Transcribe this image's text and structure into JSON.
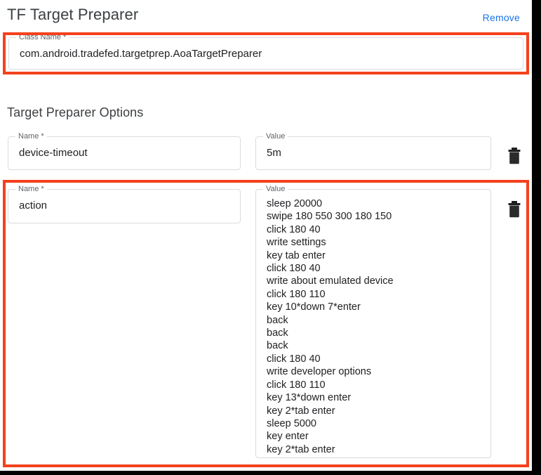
{
  "header": {
    "title": "TF Target Preparer",
    "remove_label": "Remove"
  },
  "class_name_field": {
    "label": "Class Name *",
    "value": "com.android.tradefed.targetprep.AoaTargetPreparer"
  },
  "options": {
    "section_title": "Target Preparer Options",
    "rows": [
      {
        "name_label": "Name *",
        "name_value": "device-timeout",
        "value_label": "Value",
        "value_value": "5m",
        "delete_icon": "trash-icon"
      },
      {
        "name_label": "Name *",
        "name_value": "action",
        "value_label": "Value",
        "value_value": "sleep 20000\nswipe 180 550 300 180 150\nclick 180 40\nwrite settings\nkey tab enter\nclick 180 40\nwrite about emulated device\nclick 180 110\nkey 10*down 7*enter\nback\nback\nback\nclick 180 40\nwrite developer options\nclick 180 110\nkey 13*down enter\nkey 2*tab enter\nsleep 5000\nkey enter\nkey 2*tab enter",
        "delete_icon": "trash-icon"
      }
    ]
  },
  "annotations": {
    "highlight_color": "#f4421d",
    "boxes": [
      {
        "name": "class-name-highlight"
      },
      {
        "name": "action-option-highlight"
      }
    ]
  },
  "colors": {
    "link": "#1a73e8",
    "text": "#202124",
    "label": "#5f6368",
    "field_border": "#dadce0",
    "highlight": "#f4421d"
  }
}
